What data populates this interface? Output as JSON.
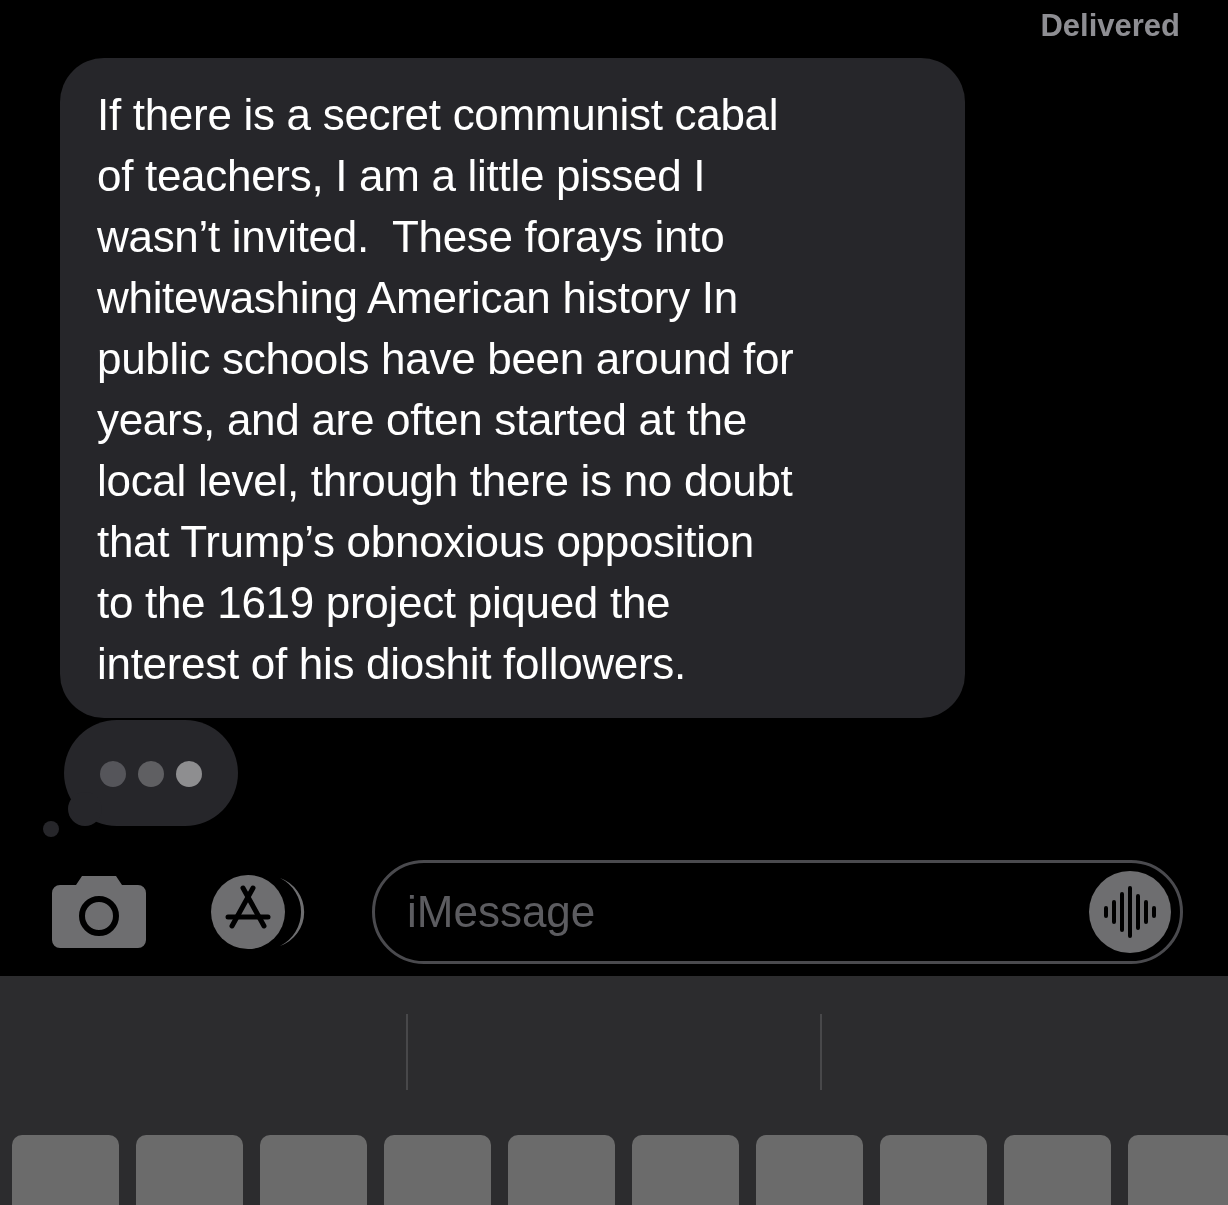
{
  "status": "Delivered",
  "message": {
    "text": "If there is a secret communist cabal\nof teachers, I am a little pissed I\nwasn’t invited.  These forays into\nwhitewashing American history In\npublic schools have been around for\nyears, and are often started at the\nlocal level, through there is no doubt\nthat Trump’s obnoxious opposition\nto the 1619 project piqued the\ninterest of his dioshit followers."
  },
  "typing_indicator": true,
  "composer": {
    "placeholder": "iMessage"
  }
}
